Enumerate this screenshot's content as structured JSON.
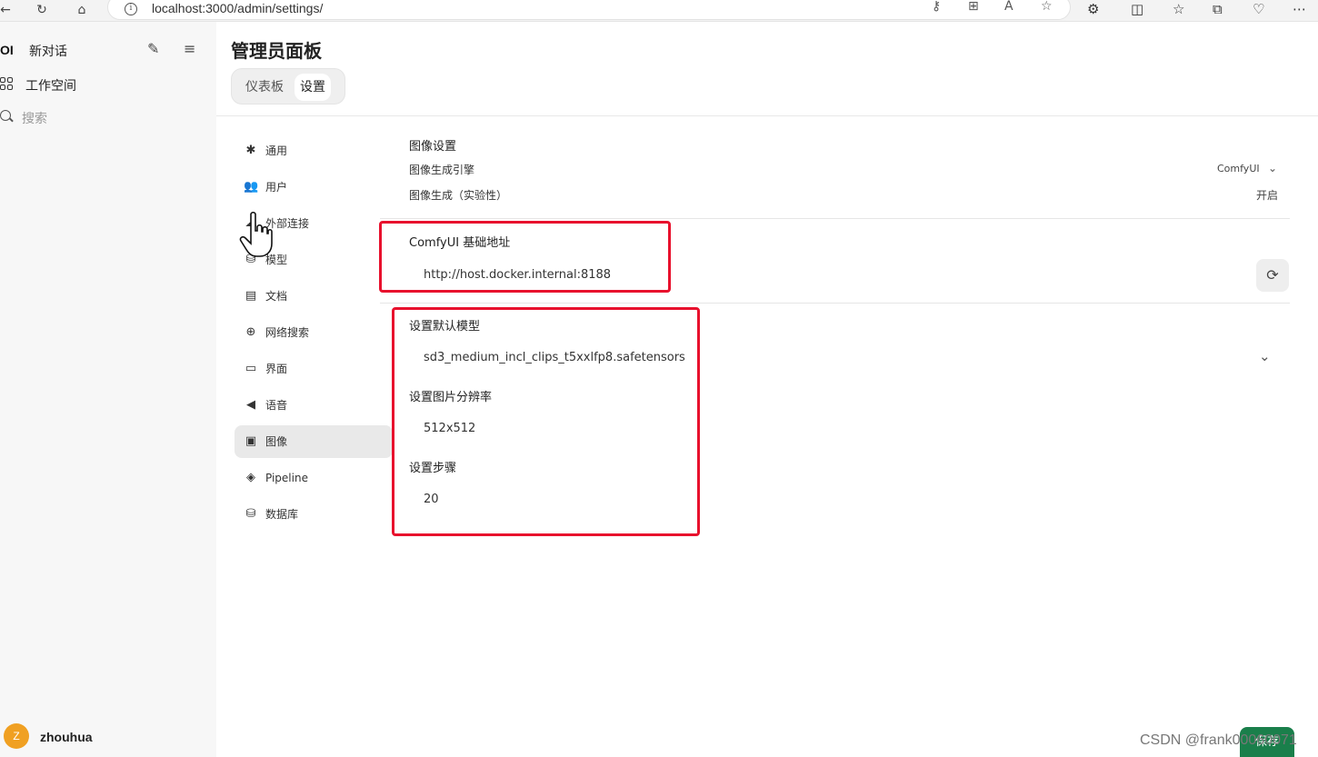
{
  "browser": {
    "url": "localhost:3000/admin/settings/",
    "icons": [
      "back-icon",
      "reload-icon",
      "home-icon",
      "info-icon",
      "key-icon",
      "apps-icon",
      "read-aloud-icon",
      "favorite-icon",
      "extensions-icon",
      "split-screen-icon",
      "favorites-icon",
      "collections-icon",
      "browser-essentials-icon",
      "more-icon"
    ]
  },
  "sidebar": {
    "logo": "OI",
    "new_chat": "新对话",
    "workspace": "工作空间",
    "search_placeholder": "搜索",
    "user": {
      "initial": "Z",
      "name": "zhouhua"
    }
  },
  "admin": {
    "title": "管理员面板",
    "tabs": [
      {
        "label": "仪表板",
        "active": false
      },
      {
        "label": "设置",
        "active": true
      }
    ]
  },
  "settings_nav": [
    {
      "label": "通用",
      "icon": "gear-icon"
    },
    {
      "label": "用户",
      "icon": "users-icon"
    },
    {
      "label": "外部连接",
      "icon": "cloud-icon"
    },
    {
      "label": "模型",
      "icon": "database-icon"
    },
    {
      "label": "文档",
      "icon": "document-icon"
    },
    {
      "label": "网络搜索",
      "icon": "globe-icon"
    },
    {
      "label": "界面",
      "icon": "monitor-icon"
    },
    {
      "label": "语音",
      "icon": "speaker-icon"
    },
    {
      "label": "图像",
      "icon": "image-icon",
      "active": true
    },
    {
      "label": "Pipeline",
      "icon": "layers-icon"
    },
    {
      "label": "数据库",
      "icon": "database-icon"
    }
  ],
  "image_settings": {
    "section_title": "图像设置",
    "engine_label": "图像生成引擎",
    "engine_value": "ComfyUI",
    "experimental_label": "图像生成（实验性）",
    "experimental_value": "开启",
    "base_url_label": "ComfyUI 基础地址",
    "base_url_value": "http://host.docker.internal:8188",
    "model_label": "设置默认模型",
    "model_value": "sd3_medium_incl_clips_t5xxlfp8.safetensors",
    "resolution_label": "设置图片分辨率",
    "resolution_value": "512x512",
    "steps_label": "设置步骤",
    "steps_value": "20",
    "save_label": "保存"
  },
  "highlight_color": "#e8112d",
  "accent_color": "#1a7f4b",
  "watermark": "CSDN @frank00060071"
}
